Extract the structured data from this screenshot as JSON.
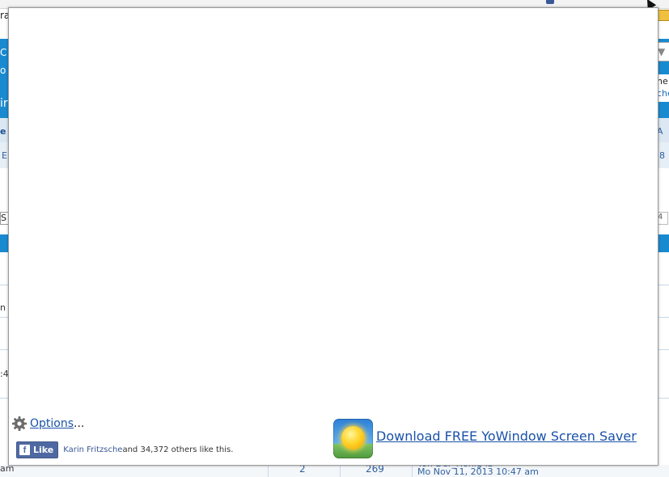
{
  "background_page": {
    "topbar_text": "ra",
    "header_lines": [
      "C",
      "o",
      "ir"
    ],
    "right_select_arrow": "▼",
    "right_text_1": "he",
    "right_text_2": "che",
    "row1_left": "e",
    "row1_right": "A",
    "row2_left": "E",
    "row2_right": "8",
    "search_box": "S",
    "pager_page": "4",
    "side_texts": [
      "n",
      ":4",
      "am"
    ],
    "bottom_row": {
      "replies": "2",
      "views": "269",
      "last_post_user": "Yoh Der_Honig-lb",
      "last_post_date": "Mo Nov 11, 2013 10:47 am"
    }
  },
  "popup": {
    "options_label": "Options",
    "options_suffix": "...",
    "facebook": {
      "like_label": "Like",
      "f_glyph": "f",
      "friend_name": "Karin Fritzsche",
      "others_text": " and 34,372 others like this."
    },
    "download_label": "Download FREE YoWindow Screen Saver"
  },
  "colors": {
    "link_blue": "#1a52a8",
    "facebook_blue": "#4e69a2",
    "forum_header_blue": "#1a8ad0"
  }
}
